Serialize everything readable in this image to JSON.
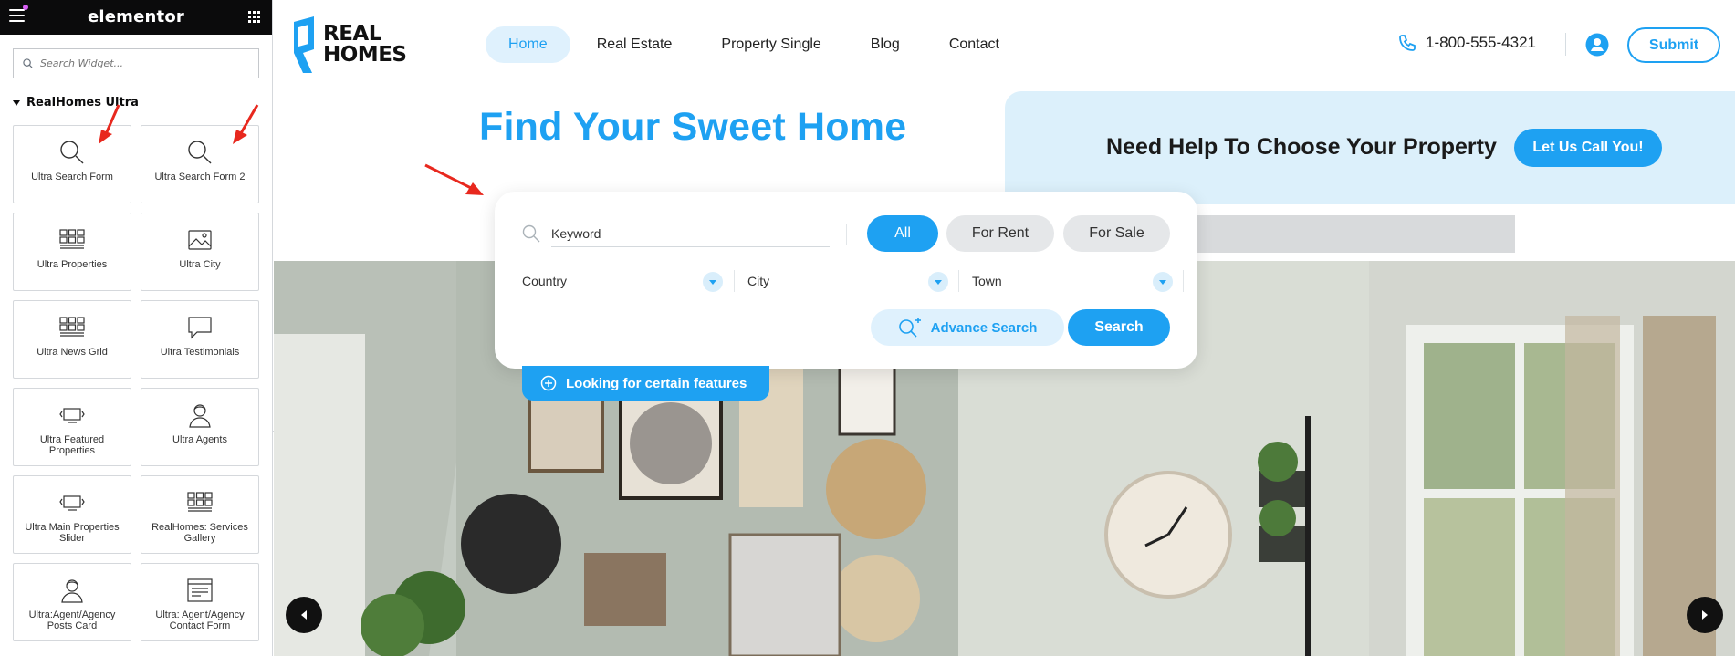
{
  "panel": {
    "title": "elementor",
    "search_placeholder": "Search Widget...",
    "category": "RealHomes Ultra",
    "widgets": [
      {
        "label": "Ultra Search Form",
        "icon": "search-icon"
      },
      {
        "label": "Ultra Search Form 2",
        "icon": "search-icon"
      },
      {
        "label": "Ultra Properties",
        "icon": "grid-icon"
      },
      {
        "label": "Ultra City",
        "icon": "image-icon"
      },
      {
        "label": "Ultra News Grid",
        "icon": "grid-icon"
      },
      {
        "label": "Ultra Testimonials",
        "icon": "speech-bubble-icon"
      },
      {
        "label": "Ultra Featured Properties",
        "icon": "slider-icon"
      },
      {
        "label": "Ultra Agents",
        "icon": "person-icon"
      },
      {
        "label": "Ultra Main Properties Slider",
        "icon": "slider-icon"
      },
      {
        "label": "RealHomes: Services Gallery",
        "icon": "grid-icon"
      },
      {
        "label": "Ultra:Agent/Agency Posts Card",
        "icon": "person-icon"
      },
      {
        "label": "Ultra: Agent/Agency Contact Form",
        "icon": "form-icon"
      }
    ]
  },
  "site": {
    "logo_line1": "REAL",
    "logo_line2": "HOMES",
    "nav": [
      "Home",
      "Real Estate",
      "Property Single",
      "Blog",
      "Contact"
    ],
    "phone": "1-800-555-4321",
    "submit": "Submit",
    "heading": "Find Your Sweet Home",
    "help_text": "Need Help To Choose Your Property",
    "call_button": "Let Us Call You!",
    "search": {
      "keyword_value": "Keyword",
      "status_tabs": [
        "All",
        "For Rent",
        "For Sale"
      ],
      "selects": [
        "Country",
        "City",
        "Town"
      ],
      "advance": "Advance Search",
      "search": "Search",
      "features": "Looking for certain features"
    }
  },
  "colors": {
    "accent": "#1ea1f2",
    "accent_light": "#dff1fd",
    "panel_header": "#0b0b0c"
  }
}
